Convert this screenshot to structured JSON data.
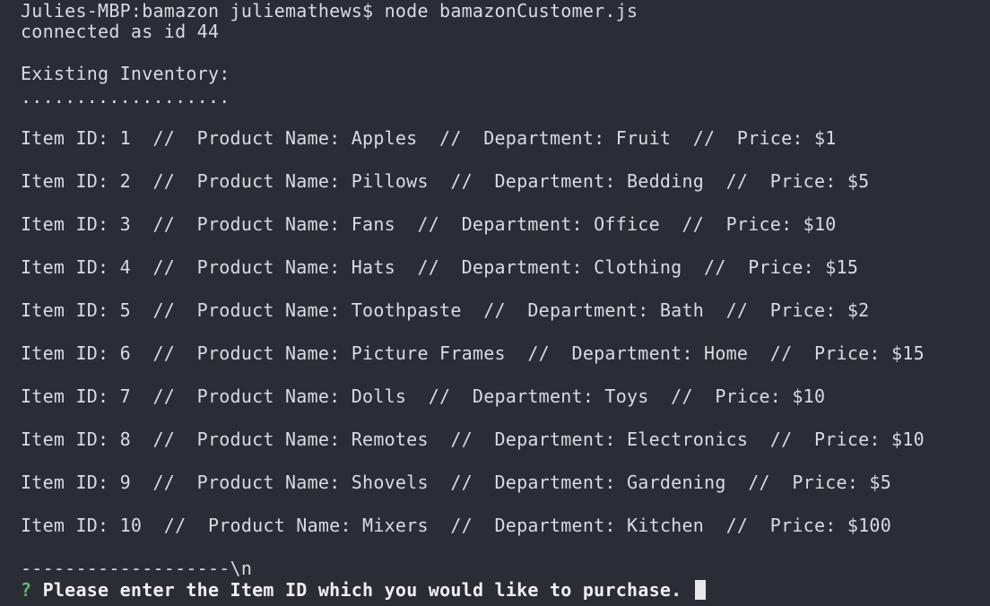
{
  "terminal": {
    "command_line": "Julies-MBP:bamazon juliemathews$ node bamazonCustomer.js",
    "connected_line": "connected as id 44",
    "inventory_heading": "Existing Inventory:",
    "dots_line": "...................",
    "inventory_lines": [
      "Item ID: 1  //  Product Name: Apples  //  Department: Fruit  //  Price: $1",
      "Item ID: 2  //  Product Name: Pillows  //  Department: Bedding  //  Price: $5",
      "Item ID: 3  //  Product Name: Fans  //  Department: Office  //  Price: $10",
      "Item ID: 4  //  Product Name: Hats  //  Department: Clothing  //  Price: $15",
      "Item ID: 5  //  Product Name: Toothpaste  //  Department: Bath  //  Price: $2",
      "Item ID: 6  //  Product Name: Picture Frames  //  Department: Home  //  Price: $15",
      "Item ID: 7  //  Product Name: Dolls  //  Department: Toys  //  Price: $10",
      "Item ID: 8  //  Product Name: Remotes  //  Department: Electronics  //  Price: $10",
      "Item ID: 9  //  Product Name: Shovels  //  Department: Gardening  //  Price: $5",
      "Item ID: 10  //  Product Name: Mixers  //  Department: Kitchen  //  Price: $100"
    ],
    "separator_line": "-------------------\\n",
    "prompt_marker": "?",
    "prompt_text": "Please enter the Item ID which you would like to purchase."
  }
}
